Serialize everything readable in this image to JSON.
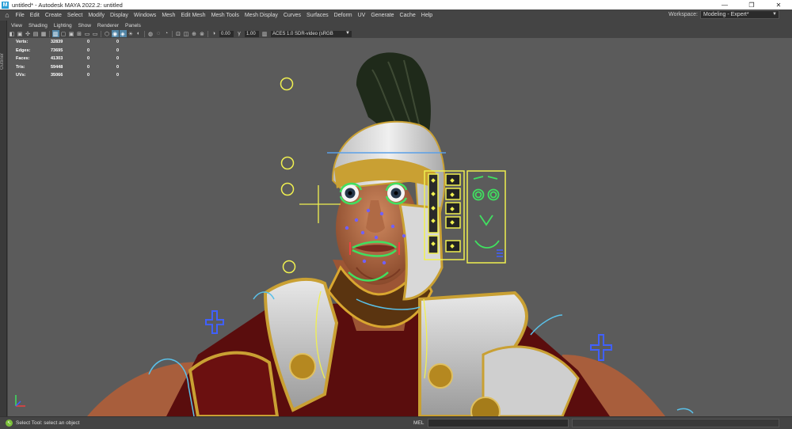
{
  "window": {
    "app_icon": "M",
    "title": "untitled* - Autodesk MAYA 2022.2: untitled",
    "minimize": "—",
    "restore": "❐",
    "close": "✕"
  },
  "menubar": {
    "items": [
      "File",
      "Edit",
      "Create",
      "Select",
      "Modify",
      "Display",
      "Windows",
      "Mesh",
      "Edit Mesh",
      "Mesh Tools",
      "Mesh Display",
      "Curves",
      "Surfaces",
      "Deform",
      "UV",
      "Generate",
      "Cache",
      "Help"
    ],
    "workspace_label": "Workspace:",
    "workspace_value": "Modeling - Expert*"
  },
  "left_strip": {
    "label": "Outliner"
  },
  "panel_menu": {
    "items": [
      "View",
      "Shading",
      "Lighting",
      "Show",
      "Renderer",
      "Panels"
    ]
  },
  "view_toolbar": {
    "exposure": "0.00",
    "gamma": "1.00",
    "color_management": "ACES 1.0 SDR-video (sRGB"
  },
  "hud": {
    "rows": [
      {
        "label": "Verts:",
        "v1": "32839",
        "v2": "0",
        "v3": "0"
      },
      {
        "label": "Edges:",
        "v1": "73695",
        "v2": "0",
        "v3": "0"
      },
      {
        "label": "Faces:",
        "v1": "41303",
        "v2": "0",
        "v3": "0"
      },
      {
        "label": "Tris:",
        "v1": "59448",
        "v2": "0",
        "v3": "0"
      },
      {
        "label": "UVs:",
        "v1": "35066",
        "v2": "0",
        "v3": "0"
      }
    ]
  },
  "statusbar": {
    "help_text": "Select Tool: select an object",
    "mel_label": "MEL"
  },
  "colors": {
    "viewport_bg": "#5b5b5b",
    "control_yellow": "#f0f050",
    "control_green": "#40e060",
    "control_blue": "#4060ff",
    "skin": "#c27a55",
    "armor_white": "#dcdcdc",
    "gold": "#c9a033",
    "cloth_red": "#6b1010"
  }
}
